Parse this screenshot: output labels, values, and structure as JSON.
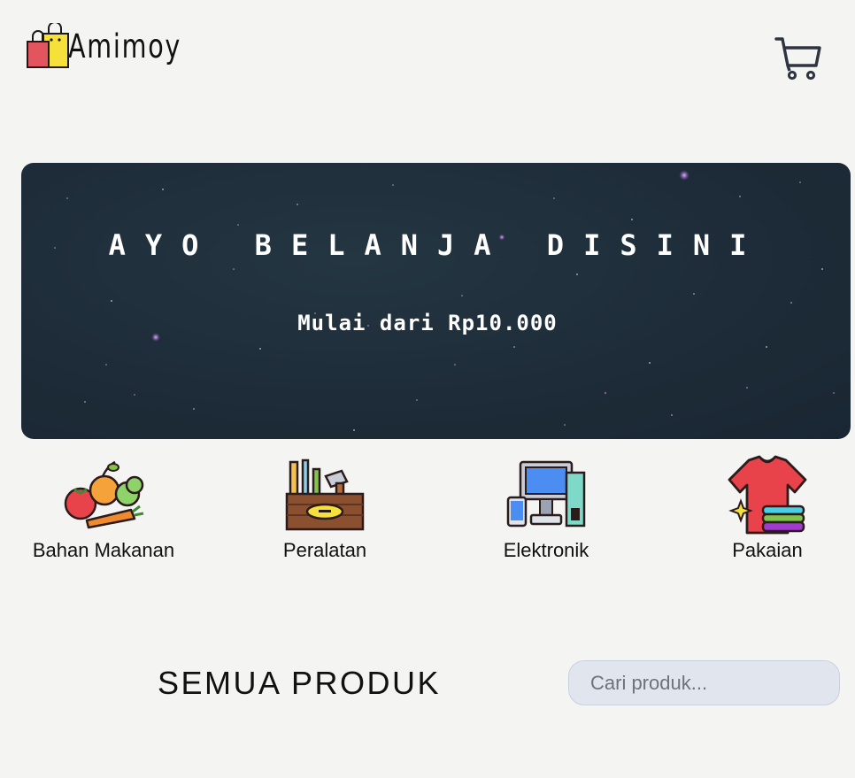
{
  "header": {
    "brand": "Amimoy",
    "cart_icon": "shopping-cart-icon",
    "logo_icon": "shopping-bags-icon"
  },
  "hero": {
    "title": "AYO BELANJA DISINI",
    "subtitle": "Mulai dari Rp10.000"
  },
  "categories": [
    {
      "label": "Bahan Makanan",
      "icon": "vegetables-icon"
    },
    {
      "label": "Peralatan",
      "icon": "toolbox-icon"
    },
    {
      "label": "Elektronik",
      "icon": "electronics-icon"
    },
    {
      "label": "Pakaian",
      "icon": "clothes-icon"
    }
  ],
  "products": {
    "title": "SEMUA PRODUK",
    "search_placeholder": "Cari produk..."
  },
  "colors": {
    "page_background": "#f4f4f2",
    "hero_background": "#1d2c38",
    "search_background": "#e1e6ee"
  }
}
